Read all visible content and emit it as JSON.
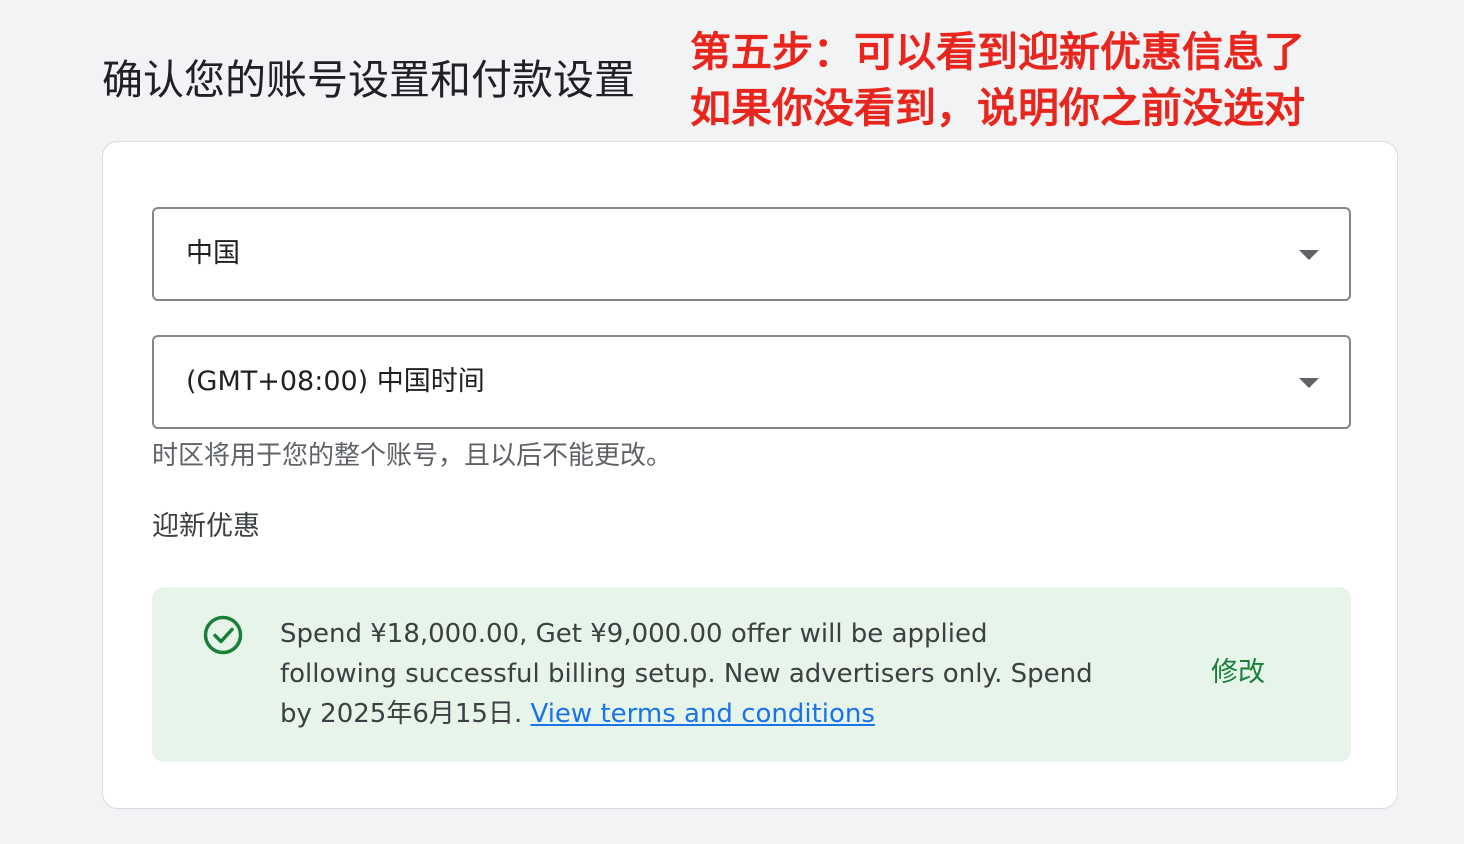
{
  "page": {
    "title": "确认您的账号设置和付款设置"
  },
  "annotation": {
    "line1": "第五步：可以看到迎新优惠信息了",
    "line2": "如果你没看到，说明你之前没选对",
    "color": "#e8261d"
  },
  "settings": {
    "country": {
      "value": "中国"
    },
    "timezone": {
      "value": "(GMT+08:00) 中国时间",
      "helper": "时区将用于您的整个账号，且以后不能更改。"
    }
  },
  "promotion": {
    "label": "迎新优惠",
    "icon": "check-circle-icon",
    "description": "Spend ¥18,000.00, Get ¥9,000.00 offer will be applied following successful billing setup. New advertisers only. Spend by 2025年6月15日.",
    "terms_link": "View terms and conditions",
    "edit_label": "修改",
    "background_color": "#e6f4ea",
    "accent_color": "#188038"
  }
}
